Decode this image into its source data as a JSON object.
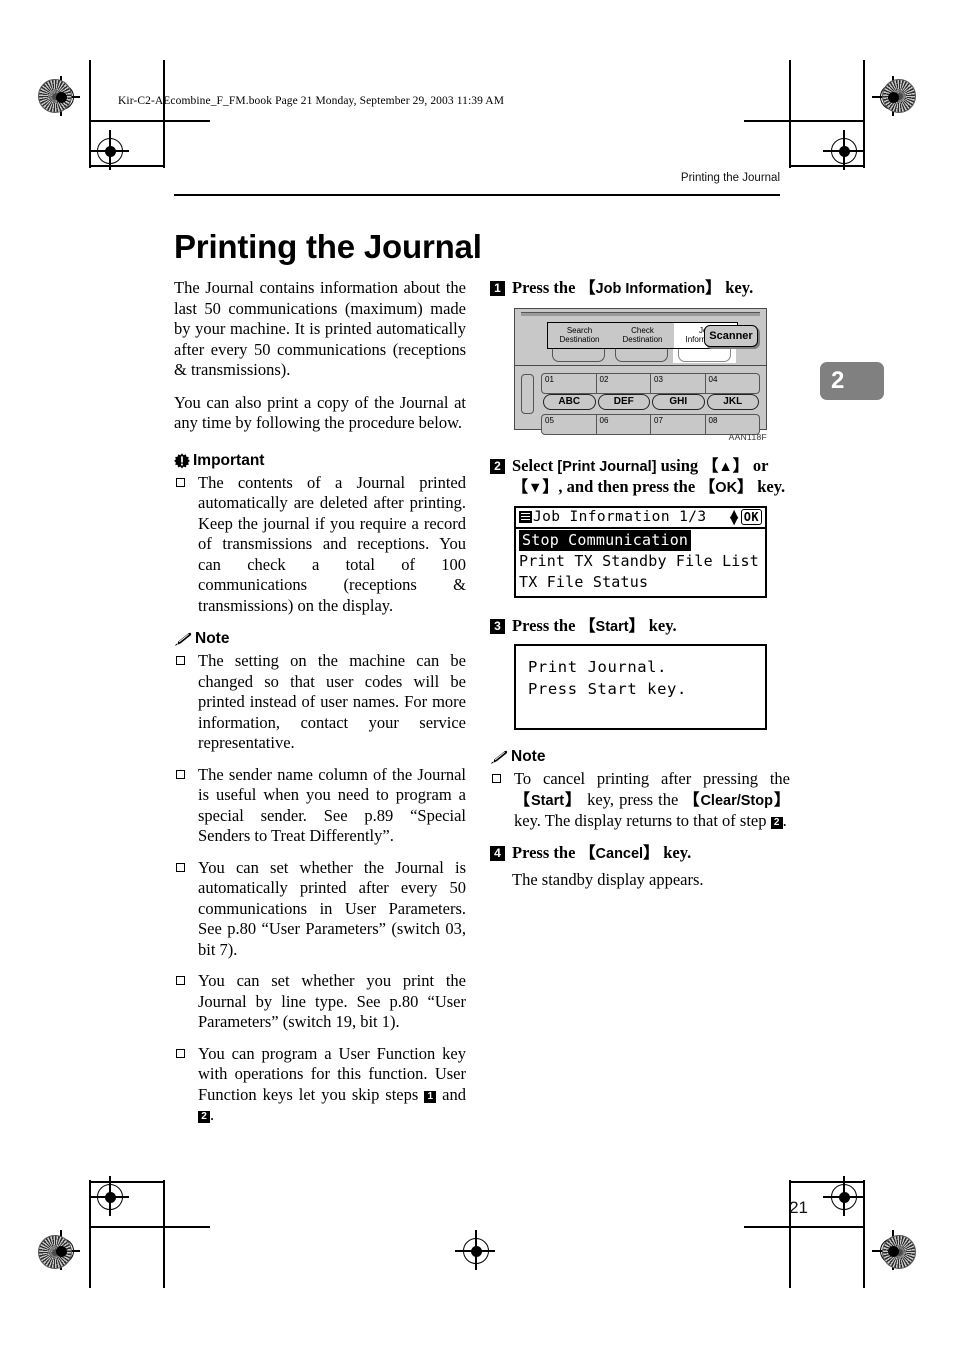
{
  "file_banner": "Kir-C2-AEcombine_F_FM.book  Page 21  Monday, September 29, 2003  11:39 AM",
  "running_head": "Printing the Journal",
  "page_title": "Printing the Journal",
  "chapter_tab": "2",
  "page_number": "21",
  "left_column": {
    "intro_paragraphs": [
      "The Journal contains information about the last 50 communications (maximum) made by your machine. It is printed automatically after every 50 communications (receptions & transmissions).",
      "You can also print a copy of the Journal at any time by following the procedure below."
    ],
    "important": {
      "heading": "Important",
      "icon": "important-icon",
      "items": [
        "The contents of a Journal printed automatically are deleted after printing. Keep the journal if you require a record of transmissions and receptions. You can check a total of 100 communications (receptions & transmissions) on the display."
      ]
    },
    "note": {
      "heading": "Note",
      "icon": "pencil-icon",
      "items": [
        "The setting on the machine can be changed so that user codes will be printed instead of user names. For more information, contact your service representative.",
        "The sender name column of the Journal is useful when you need to program a special sender. See p.89 “Special Senders to Treat Differently”.",
        "You can set whether the Journal is automatically printed after every 50 communications in User Parameters. See p.80 “User Parameters” (switch 03, bit 7).",
        "You can set whether you print the Journal by line type. See p.80 “User Parameters” (switch 19, bit 1)."
      ],
      "last_item_parts": {
        "a": "You can program a User Function key with operations for this function. User Function keys let you skip steps ",
        "num1": "1",
        "b": " and ",
        "num2": "2",
        "c": "."
      }
    }
  },
  "right_column": {
    "step1": {
      "number": "1",
      "text_before": "Press the ",
      "key_label": "Job Information",
      "text_after": " key."
    },
    "panel_figure": {
      "name": "operation-panel-figure",
      "tabs": [
        {
          "line1": "Search",
          "line2": "Destination",
          "selected": false
        },
        {
          "line1": "Check",
          "line2": "Destination",
          "selected": false
        },
        {
          "line1": "Job",
          "line2": "Information",
          "selected": true
        }
      ],
      "scanner_key": "Scanner",
      "number_keys_row1": [
        "01",
        "02",
        "03",
        "04"
      ],
      "letter_keys": [
        "ABC",
        "DEF",
        "GHI",
        "JKL"
      ],
      "number_keys_row2": [
        "05",
        "06",
        "07",
        "08"
      ],
      "figure_code": "AAN118F"
    },
    "step2": {
      "number": "2",
      "t1": "Select ",
      "bracket_item": "[Print Journal]",
      "t2": " using ",
      "key_up": "▲",
      "t3": " or ",
      "key_down": "▼",
      "t4": ", and then press the ",
      "key_ok": "OK",
      "t5": " key."
    },
    "lcd_menu": {
      "name": "job-information-lcd",
      "title": "Job Information 1/3",
      "ok_label": "OK",
      "items": [
        {
          "label": "Stop Communication",
          "selected": true
        },
        {
          "label": "Print TX Standby File List",
          "selected": false
        },
        {
          "label": "TX File Status",
          "selected": false
        }
      ]
    },
    "step3": {
      "number": "3",
      "text_before": "Press the ",
      "key_label": "Start",
      "text_after": " key."
    },
    "lcd_message": {
      "name": "print-journal-lcd",
      "lines": [
        "Print Journal.",
        "Press Start key."
      ]
    },
    "note": {
      "heading": "Note",
      "icon": "pencil-icon",
      "item": {
        "t1": "To cancel printing after pressing the ",
        "key_start": "Start",
        "t2": " key, press the ",
        "key_clear_stop": "Clear/Stop",
        "t3": " key. The display returns to that of step ",
        "step_ref": "2",
        "t4": "."
      }
    },
    "step4": {
      "number": "4",
      "text_before": "Press the ",
      "key_label": "Cancel",
      "text_after": " key.",
      "body": "The standby display appears."
    }
  }
}
